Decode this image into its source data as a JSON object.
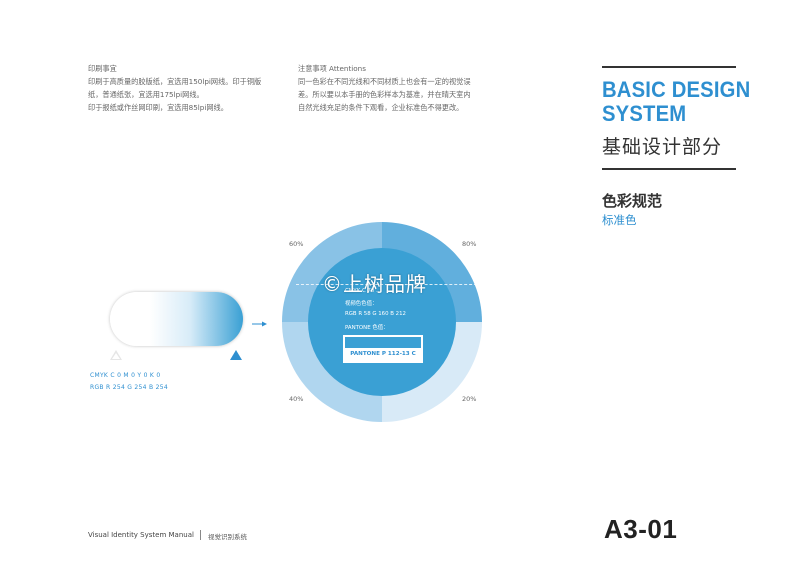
{
  "notes": {
    "print": "印刷事宜\n印刷于高质量的胶版纸，宜选用150lpi网线。印于铜版\n纸，普通纸张，宜选用175lpi网线。\n印于报纸或作丝网印刷，宜选用85lpi网线。",
    "attention": "注意事项 Attentions\n同一色彩在不同光线和不同材质上也会有一定的视觉误\n差。所以要以本手册的色彩样本为基准，并在晴天室内\n自然光线充足的条件下观看，企业标准色不得更改。"
  },
  "brand": {
    "title": "BASIC DESIGN SYSTEM",
    "subtitle": "基础设计部分",
    "accent": "#2e8fd0"
  },
  "section": {
    "title": "色彩规范",
    "subtitle": "标准色"
  },
  "white_sample": {
    "cmyk": "CMYK   C 0  M 0  Y 0  K 0",
    "rgb": "RGB   R 254  G 254  B 254"
  },
  "blue_sample": {
    "cmyk": "CMYK   C 70 ...",
    "label": "视频色色值：",
    "rgb": "RGB      R 58  G 160  B 212",
    "pantone_label": "PANTONE 色值：",
    "pantone_code": "PANTONE P 112-13 C",
    "color": "#3aa0d4"
  },
  "tints": {
    "top_left": "60%",
    "top_right": "80%",
    "bottom_left": "40%",
    "bottom_right": "20%"
  },
  "watermark": "©上树品牌",
  "footer": {
    "manual": "Visual Identity System Manual",
    "system": "视觉识别系统",
    "page": "A3-01"
  }
}
